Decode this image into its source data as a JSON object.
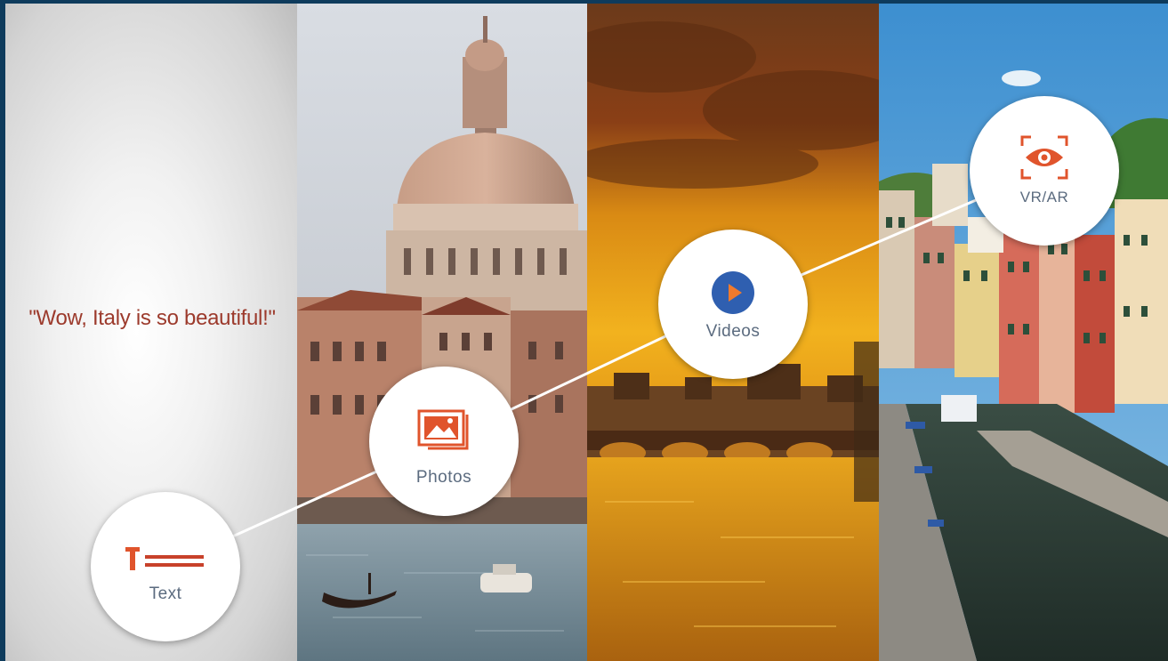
{
  "quote": {
    "text": "\"Wow, Italy is so beautiful!\""
  },
  "badges": {
    "text": {
      "label": "Text",
      "icon": "text-icon"
    },
    "photos": {
      "label": "Photos",
      "icon": "image-icon"
    },
    "videos": {
      "label": "Videos",
      "icon": "play-icon"
    },
    "vrar": {
      "label": "VR/AR",
      "icon": "eye-scan-icon"
    }
  },
  "colors": {
    "accent": "#e0542c",
    "video_blue": "#2f5fb0",
    "quote": "#9c3a2c",
    "label": "#5b6b7f",
    "frame": "#0e3b5c"
  },
  "panels": [
    "plain-gradient",
    "venice-basilica-photo",
    "sunset-river-photo",
    "cinque-terre-village-photo"
  ]
}
